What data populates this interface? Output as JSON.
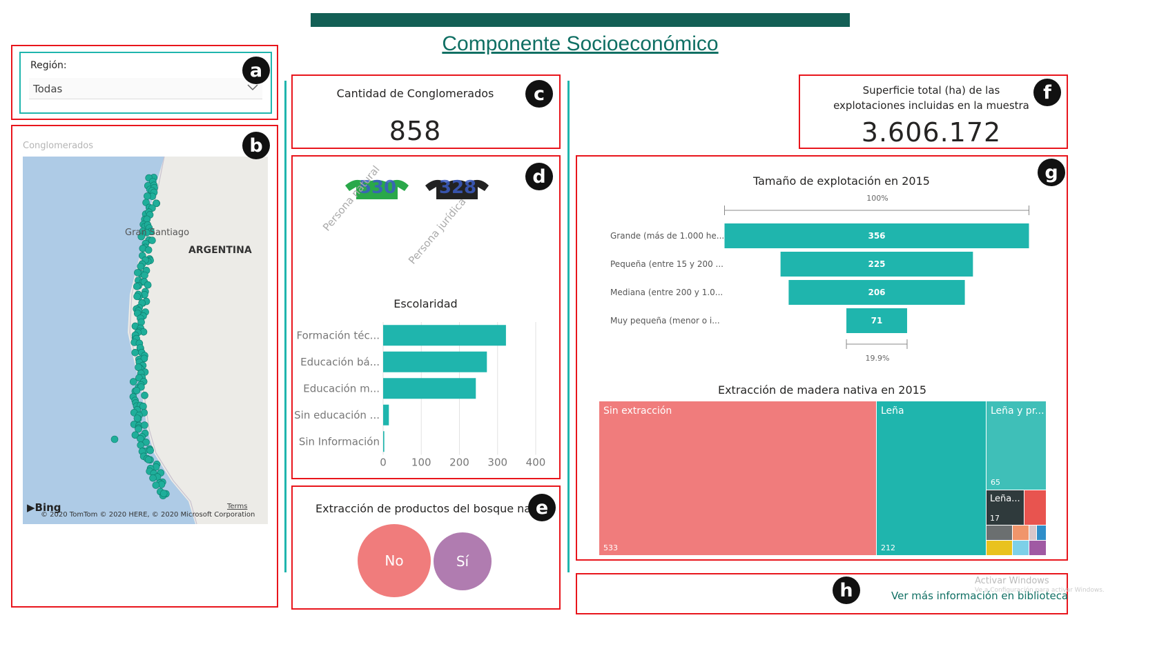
{
  "header": {
    "title": "Componente Socioeconómico",
    "bar_color": "#135f55",
    "title_color": "#0f6f63"
  },
  "colors": {
    "teal": "#1fb5ad",
    "red_outline": "#e8141b",
    "salmon": "#f07c7c",
    "purple": "#b07cb0"
  },
  "badges": [
    "a",
    "b",
    "c",
    "d",
    "e",
    "f",
    "g",
    "h"
  ],
  "region_filter": {
    "label": "Región:",
    "value": "Todas",
    "icon": "chevron-down-icon"
  },
  "map": {
    "title": "Conglomerados",
    "label_country": "ARGENTINA",
    "label_city": "Gran Santiago",
    "attribution": "© 2020 TomTom © 2020 HERE, © 2020 Microsoft Corporation",
    "terms": "Terms",
    "logo_text": "Bing"
  },
  "card_c": {
    "title": "Cantidad de Conglomerados",
    "value": "858"
  },
  "card_d": {
    "persons": [
      {
        "value": "530",
        "label": "Persona natural",
        "color": "#2aa84a"
      },
      {
        "value": "328",
        "label": "Persona jurídica",
        "color": "#222222"
      }
    ],
    "chart_title": "Escolaridad"
  },
  "card_e": {
    "title": "Extracción de productos del bosque nativ...",
    "bubbles": [
      {
        "label": "No",
        "color": "#f07c7c"
      },
      {
        "label": "Sí",
        "color": "#b07cb0"
      }
    ]
  },
  "card_f": {
    "title_line1": "Superficie total (ha) de las",
    "title_line2": "explotaciones incluidas en la muestra",
    "value": "3.606.172"
  },
  "card_g": {
    "funnel_title": "Tamaño de explotación en 2015",
    "top_pct": "100%",
    "bottom_pct": "19.9%",
    "treemap_title": "Extracción de madera nativa en 2015",
    "treemap": {
      "cells": [
        {
          "label": "Sin extracción",
          "value": "533",
          "color": "#f07c7c"
        },
        {
          "label": "Leña",
          "value": "212",
          "color": "#1fb5ad"
        },
        {
          "label": "Leña y pr...",
          "value": "65",
          "color": "#3fbfb8"
        },
        {
          "label": "Leña...",
          "value": "17",
          "color": "#2f3a3c"
        }
      ]
    }
  },
  "card_h": {
    "link": "Ver más información en biblioteca",
    "watermark_line1": "Activar Windows",
    "watermark_line2": "Ve a Configuración para activar Windows."
  },
  "chart_data": [
    {
      "type": "bar",
      "orientation": "horizontal",
      "title": "Escolaridad",
      "categories": [
        "Formación téc...",
        "Educación bá...",
        "Educación m...",
        "Sin educación ...",
        "Sin Información"
      ],
      "values": [
        322,
        272,
        243,
        15,
        3
      ],
      "xlim": [
        0,
        400
      ],
      "xticks": [
        "0",
        "100",
        "200",
        "300",
        "400"
      ],
      "color": "#1fb5ad",
      "grid": true
    },
    {
      "type": "bar",
      "subtype": "funnel",
      "title": "Tamaño de explotación en 2015",
      "categories": [
        "Grande (más de 1.000 he...",
        "Pequeña (entre 15 y 200 ...",
        "Mediana (entre 200 y 1.0...",
        "Muy pequeña (menor o i..."
      ],
      "values": [
        356,
        225,
        206,
        71
      ],
      "color": "#1fb5ad"
    }
  ]
}
